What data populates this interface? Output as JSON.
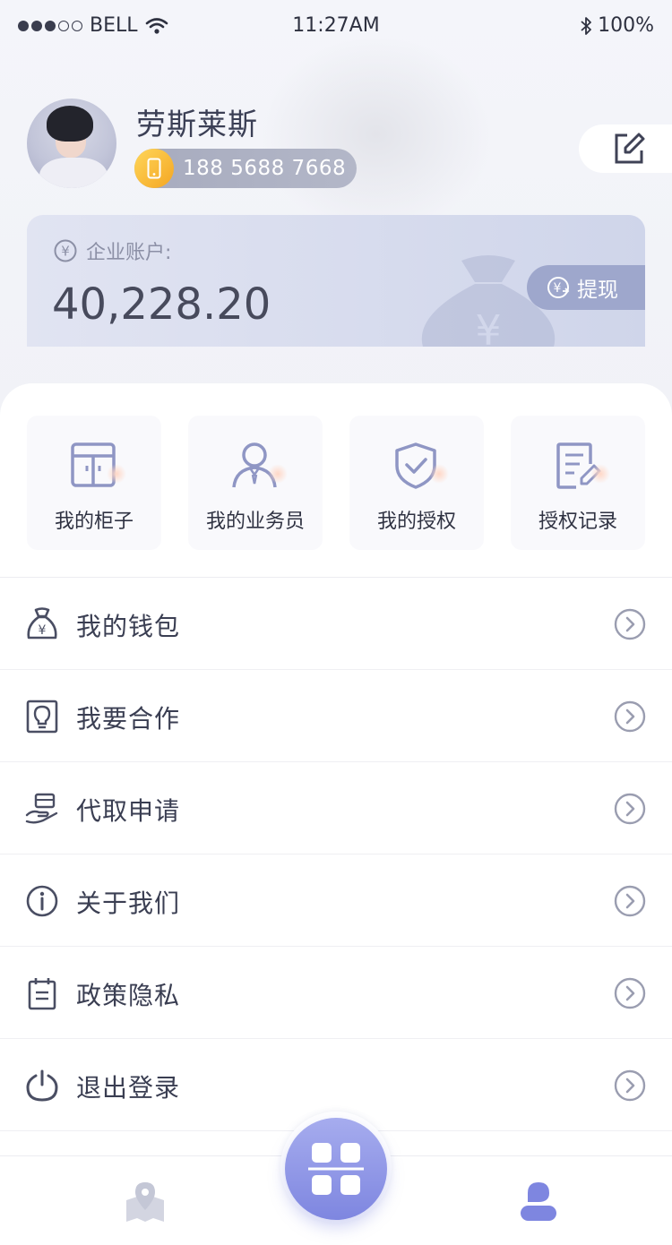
{
  "status_bar": {
    "carrier": "BELL",
    "time": "11:27AM",
    "battery": "100%",
    "signal_dots_filled": 3,
    "signal_dots_total": 5
  },
  "profile": {
    "name": "劳斯莱斯",
    "phone": "188 5688 7668"
  },
  "account": {
    "label": "企业账户:",
    "amount": "40,228.20",
    "withdraw_label": "提现"
  },
  "quick_actions": [
    {
      "label": "我的柜子",
      "icon": "cabinet-icon"
    },
    {
      "label": "我的业务员",
      "icon": "salesperson-icon"
    },
    {
      "label": "我的授权",
      "icon": "shield-check-icon"
    },
    {
      "label": "授权记录",
      "icon": "record-edit-icon"
    }
  ],
  "menu": [
    {
      "label": "我的钱包",
      "icon": "wallet-bag-icon"
    },
    {
      "label": "我要合作",
      "icon": "lightbulb-icon"
    },
    {
      "label": "代取申请",
      "icon": "hand-parcel-icon"
    },
    {
      "label": "关于我们",
      "icon": "info-icon"
    },
    {
      "label": "政策隐私",
      "icon": "clipboard-icon"
    },
    {
      "label": "退出登录",
      "icon": "power-icon"
    }
  ],
  "tabbar": {
    "items": [
      "map-pin-icon",
      "grid-icon",
      "user-icon"
    ],
    "active": "user-icon"
  },
  "colors": {
    "accent": "#7e86e0",
    "text_primary": "#3a3e52",
    "card_bg": "#d5dbee",
    "withdraw_bg": "#9ea7cc",
    "phone_icon": "#f4a623"
  }
}
